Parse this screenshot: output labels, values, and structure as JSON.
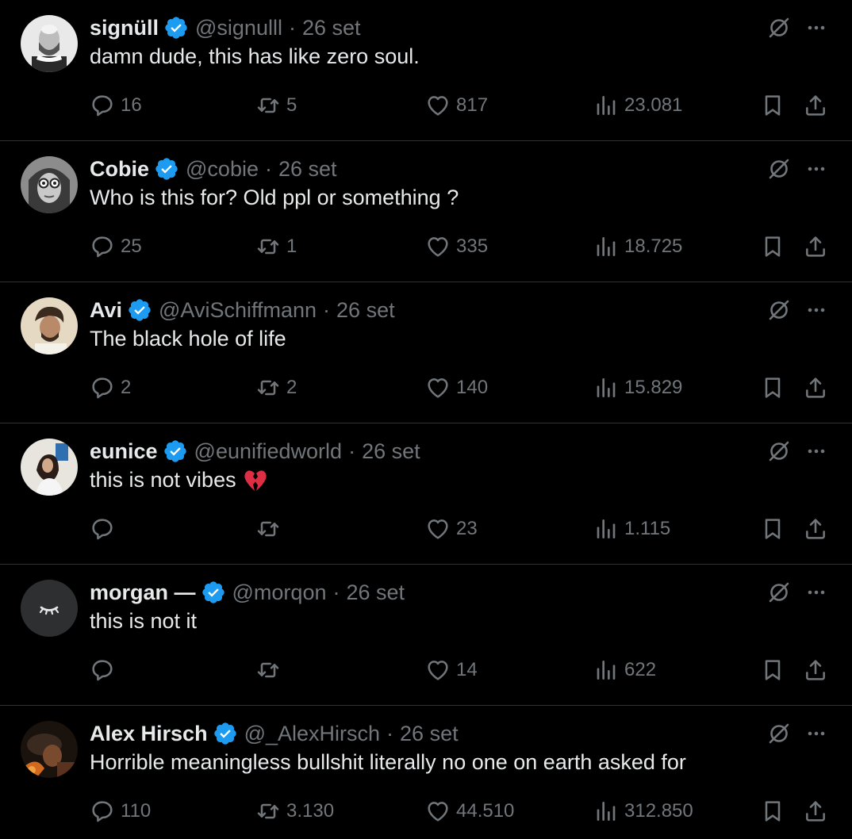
{
  "tweets": [
    {
      "name": "signüll",
      "handle": "@signulll",
      "date": "26 set",
      "text": "damn dude, this has like zero soul.",
      "emoji": "",
      "replies": "16",
      "retweets": "5",
      "likes": "817",
      "views": "23.081"
    },
    {
      "name": "Cobie",
      "handle": "@cobie",
      "date": "26 set",
      "text": "Who is this for? Old ppl or something ?",
      "emoji": "",
      "replies": "25",
      "retweets": "1",
      "likes": "335",
      "views": "18.725"
    },
    {
      "name": "Avi",
      "handle": "@AviSchiffmann",
      "date": "26 set",
      "text": "The black hole of life",
      "emoji": "",
      "replies": "2",
      "retweets": "2",
      "likes": "140",
      "views": "15.829"
    },
    {
      "name": "eunice",
      "handle": "@eunifiedworld",
      "date": "26 set",
      "text": "this is not vibes",
      "emoji": "broken-heart",
      "replies": "",
      "retweets": "",
      "likes": "23",
      "views": "1.115"
    },
    {
      "name": "morgan —",
      "handle": "@morqon",
      "date": "26 set",
      "text": "this is not it",
      "emoji": "",
      "replies": "",
      "retweets": "",
      "likes": "14",
      "views": "622"
    },
    {
      "name": "Alex Hirsch",
      "handle": "@_AlexHirsch",
      "date": "26 set",
      "text": "Horrible meaningless bullshit literally no one on earth asked for",
      "emoji": "",
      "replies": "110",
      "retweets": "3.130",
      "likes": "44.510",
      "views": "312.850"
    }
  ],
  "separator": "·",
  "colors": {
    "background": "#000000",
    "text": "#e7e9ea",
    "muted": "#71767b",
    "divider": "#2f3336",
    "verified": "#1d9bf0"
  },
  "icons": {
    "verified": "verified-badge-icon",
    "grok": "grok-icon",
    "more": "more-icon",
    "reply": "reply-icon",
    "retweet": "retweet-icon",
    "like": "heart-icon",
    "views": "views-icon",
    "bookmark": "bookmark-icon",
    "share": "share-icon"
  }
}
